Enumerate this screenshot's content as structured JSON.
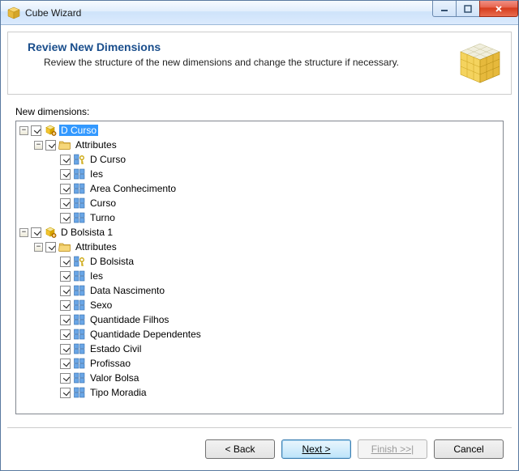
{
  "window": {
    "title": "Cube Wizard"
  },
  "header": {
    "title": "Review New Dimensions",
    "subtitle": "Review the structure of the new dimensions and change the structure if necessary."
  },
  "labels": {
    "new_dimensions": "New dimensions:"
  },
  "tree": {
    "selected_path": "0",
    "nodes": [
      {
        "label": "D Curso",
        "icon": "dimension",
        "checked": true,
        "expanded": true,
        "children": [
          {
            "label": "Attributes",
            "icon": "folder",
            "checked": true,
            "expanded": true,
            "children": [
              {
                "label": "D Curso",
                "icon": "key-attr",
                "checked": true
              },
              {
                "label": "Ies",
                "icon": "attr",
                "checked": true
              },
              {
                "label": "Area Conhecimento",
                "icon": "attr",
                "checked": true
              },
              {
                "label": "Curso",
                "icon": "attr",
                "checked": true
              },
              {
                "label": "Turno",
                "icon": "attr",
                "checked": true
              }
            ]
          }
        ]
      },
      {
        "label": "D Bolsista 1",
        "icon": "dimension",
        "checked": true,
        "expanded": true,
        "children": [
          {
            "label": "Attributes",
            "icon": "folder",
            "checked": true,
            "expanded": true,
            "children": [
              {
                "label": "D Bolsista",
                "icon": "key-attr",
                "checked": true
              },
              {
                "label": "Ies",
                "icon": "attr",
                "checked": true
              },
              {
                "label": "Data Nascimento",
                "icon": "attr",
                "checked": true
              },
              {
                "label": "Sexo",
                "icon": "attr",
                "checked": true
              },
              {
                "label": "Quantidade Filhos",
                "icon": "attr",
                "checked": true
              },
              {
                "label": "Quantidade Dependentes",
                "icon": "attr",
                "checked": true
              },
              {
                "label": "Estado Civil",
                "icon": "attr",
                "checked": true
              },
              {
                "label": "Profissao",
                "icon": "attr",
                "checked": true
              },
              {
                "label": "Valor Bolsa",
                "icon": "attr",
                "checked": true
              },
              {
                "label": "Tipo Moradia",
                "icon": "attr",
                "checked": true
              }
            ]
          }
        ]
      }
    ]
  },
  "buttons": {
    "back": "< Back",
    "next": "Next >",
    "finish": "Finish >>|",
    "cancel": "Cancel",
    "finish_enabled": false
  }
}
